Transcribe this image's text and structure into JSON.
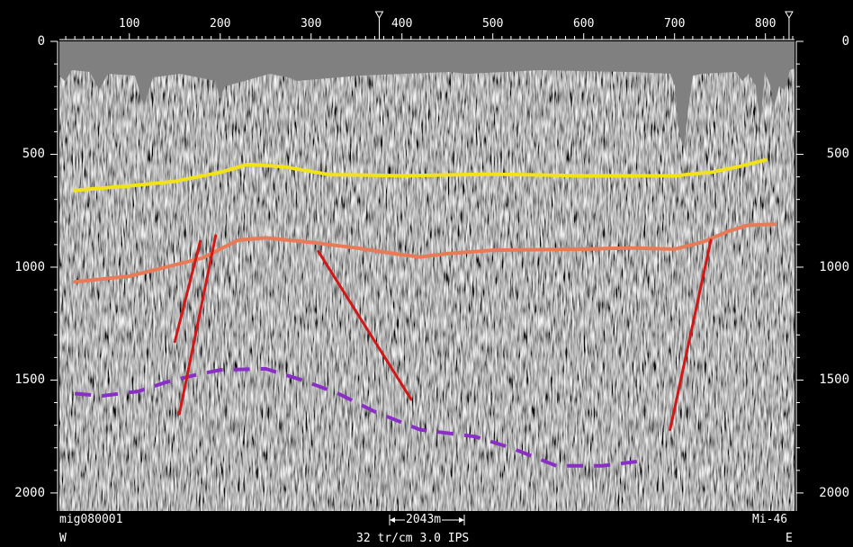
{
  "top_axis": {
    "ticks": [
      "100",
      "200",
      "300",
      "400",
      "500",
      "600",
      "700",
      "800"
    ],
    "tick_values": [
      100,
      200,
      300,
      400,
      500,
      600,
      700,
      800
    ],
    "range": [
      23,
      832
    ],
    "markers": [
      {
        "value": 375
      },
      {
        "value": 826
      }
    ]
  },
  "left_axis": {
    "ticks": [
      "0",
      "500",
      "1000",
      "1500",
      "2000"
    ],
    "tick_values": [
      0,
      500,
      1000,
      1500,
      2000
    ],
    "range": [
      0,
      2080
    ]
  },
  "right_axis": {
    "ticks": [
      "0",
      "500",
      "1000",
      "1500",
      "2000"
    ]
  },
  "footer": {
    "line_name": "mig080001",
    "scale_bar": "2043m",
    "survey_id": "Mi-46",
    "west": "W",
    "east": "E",
    "params": "32 tr/cm 3.0 IPS"
  },
  "colors": {
    "background": "#000000",
    "seismic_gray": "#808080",
    "yellow_horizon": "#f1e21a",
    "orange_horizon": "#e97a57",
    "fault": "#d01818",
    "purple_horizon": "#8a2fc6"
  },
  "interpretation": {
    "horizons": [
      {
        "color": "yellow",
        "points": [
          [
            40,
            660
          ],
          [
            100,
            640
          ],
          [
            150,
            620
          ],
          [
            200,
            580
          ],
          [
            230,
            545
          ],
          [
            270,
            555
          ],
          [
            320,
            590
          ],
          [
            400,
            595
          ],
          [
            500,
            588
          ],
          [
            600,
            595
          ],
          [
            700,
            595
          ],
          [
            740,
            580
          ],
          [
            770,
            555
          ],
          [
            800,
            525
          ]
        ]
      },
      {
        "color": "orange",
        "points": [
          [
            40,
            1065
          ],
          [
            100,
            1040
          ],
          [
            140,
            1000
          ],
          [
            180,
            960
          ],
          [
            220,
            880
          ],
          [
            250,
            870
          ],
          [
            300,
            890
          ],
          [
            350,
            915
          ],
          [
            400,
            945
          ],
          [
            420,
            955
          ],
          [
            450,
            940
          ],
          [
            500,
            925
          ],
          [
            600,
            920
          ],
          [
            650,
            915
          ],
          [
            700,
            920
          ],
          [
            730,
            890
          ],
          [
            760,
            840
          ],
          [
            780,
            815
          ],
          [
            810,
            810
          ]
        ]
      },
      {
        "color": "purple-dashed",
        "points": [
          [
            40,
            1560
          ],
          [
            70,
            1570
          ],
          [
            110,
            1550
          ],
          [
            140,
            1510
          ],
          [
            170,
            1480
          ],
          [
            200,
            1455
          ],
          [
            250,
            1450
          ],
          [
            290,
            1500
          ],
          [
            330,
            1560
          ],
          [
            370,
            1640
          ],
          [
            420,
            1720
          ],
          [
            480,
            1750
          ],
          [
            520,
            1800
          ],
          [
            570,
            1880
          ],
          [
            620,
            1880
          ],
          [
            660,
            1860
          ]
        ]
      }
    ],
    "faults": [
      {
        "points": [
          [
            178,
            885
          ],
          [
            150,
            1330
          ]
        ]
      },
      {
        "points": [
          [
            195,
            860
          ],
          [
            155,
            1650
          ]
        ]
      },
      {
        "points": [
          [
            308,
            930
          ],
          [
            410,
            1585
          ]
        ]
      },
      {
        "points": [
          [
            740,
            880
          ],
          [
            695,
            1720
          ]
        ]
      }
    ]
  }
}
